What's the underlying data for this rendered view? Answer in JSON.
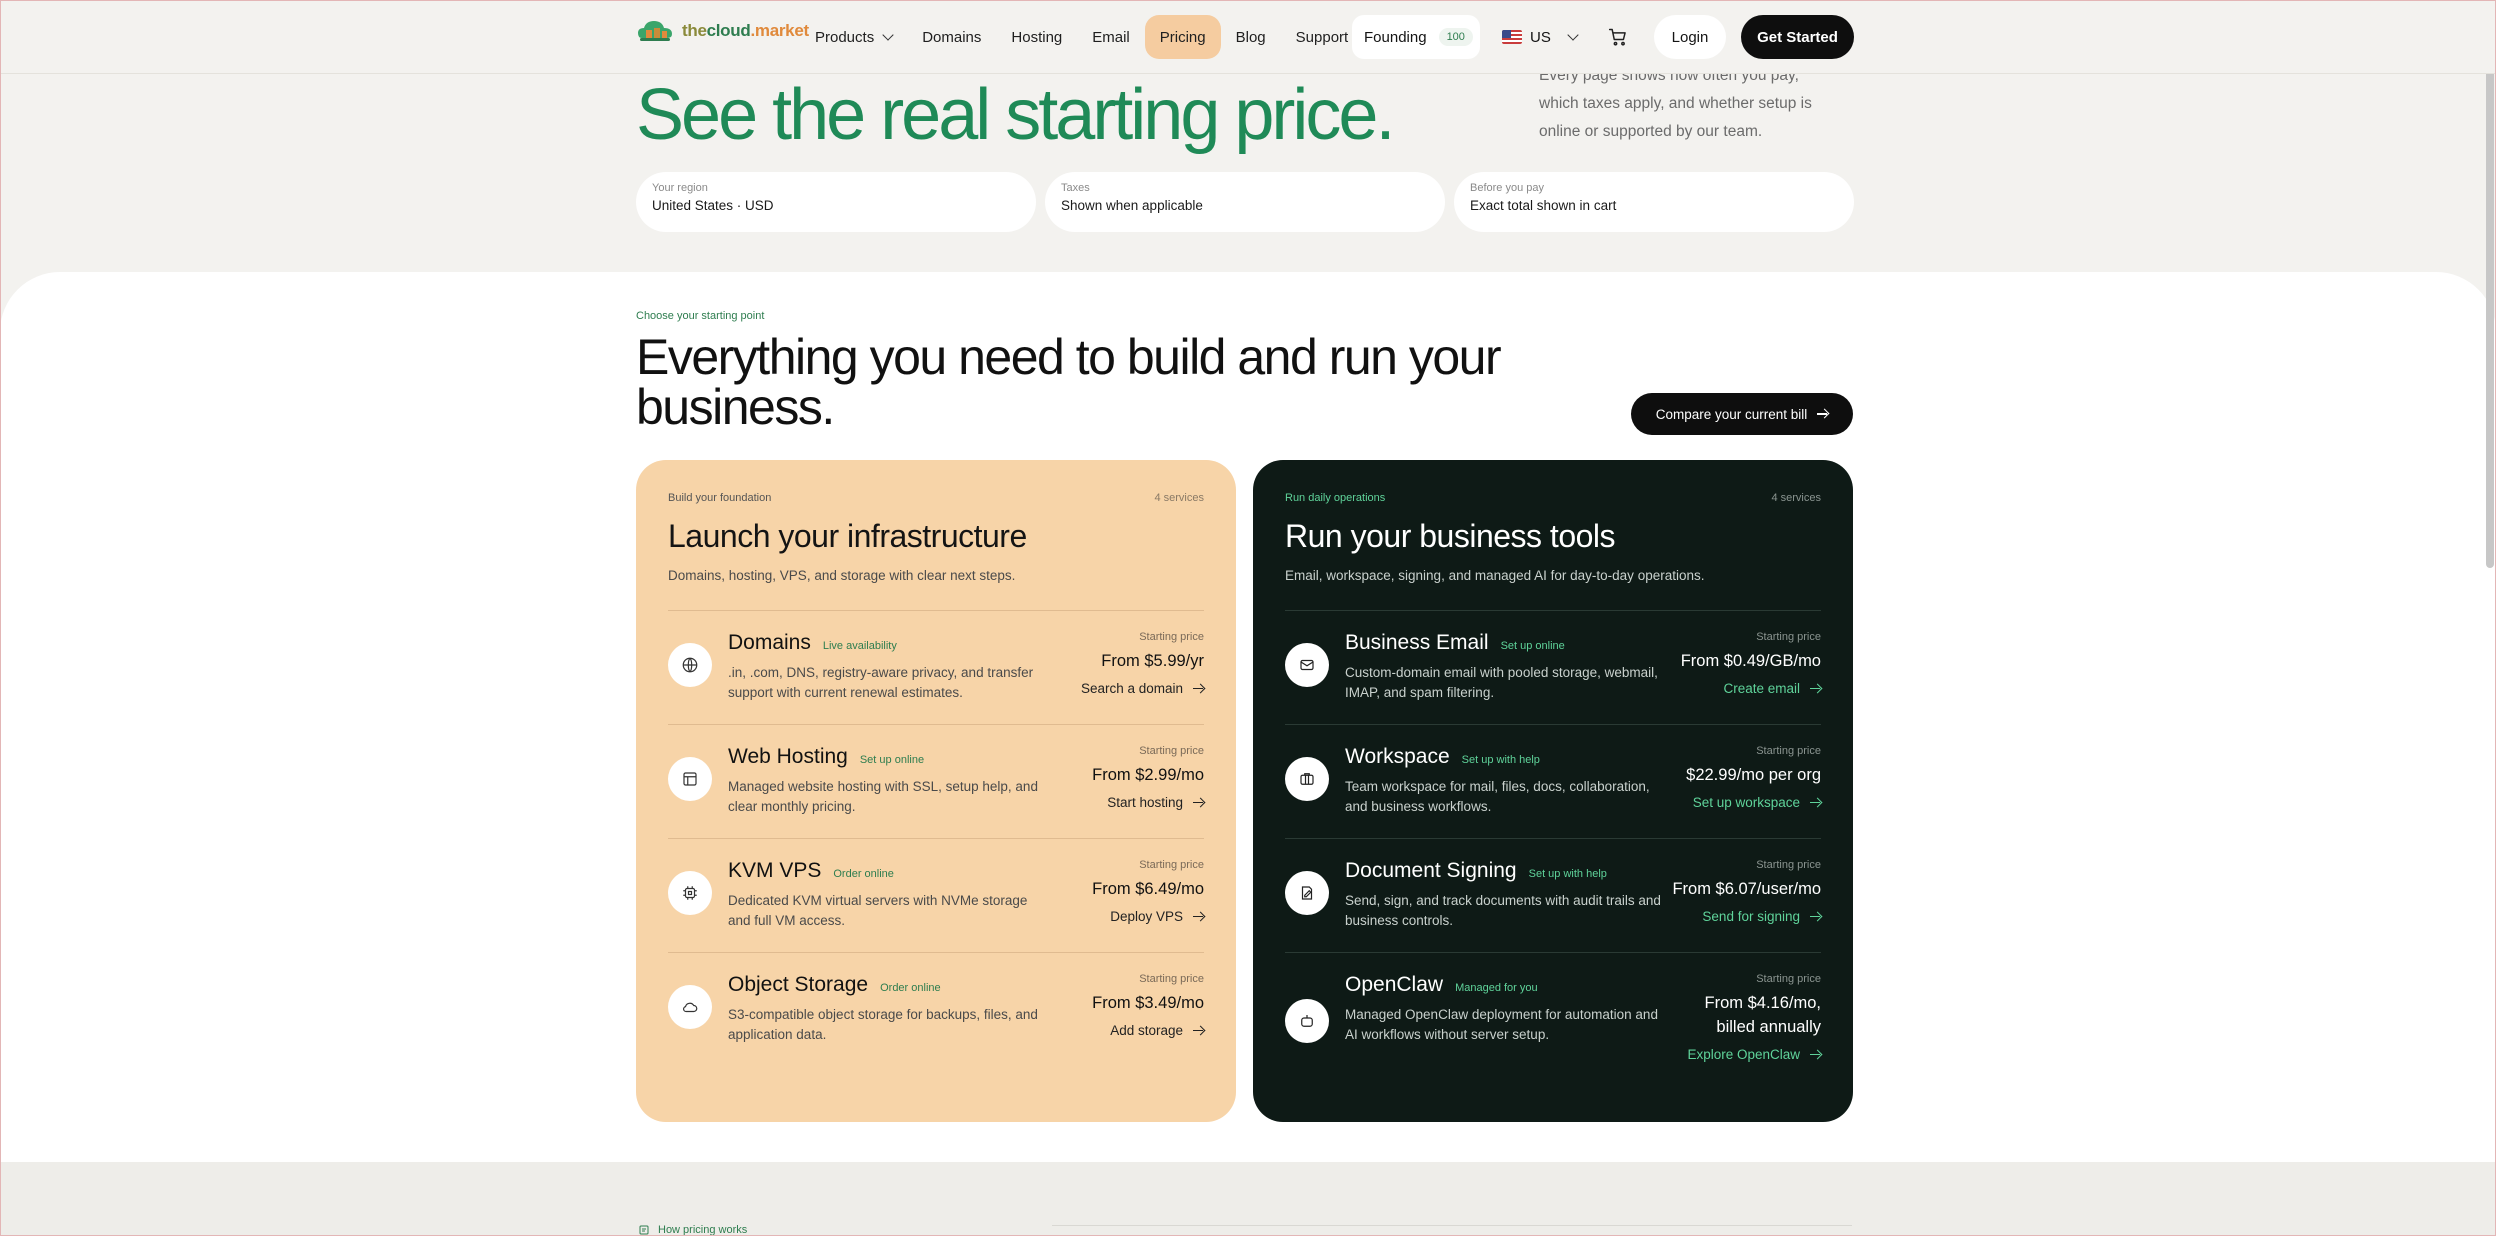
{
  "nav": {
    "logo": {
      "part1": "the",
      "part2": "cloud",
      "part3": ".market"
    },
    "links": [
      "Products",
      "Domains",
      "Hosting",
      "Email",
      "Pricing",
      "Blog",
      "Support"
    ],
    "active_link": "Pricing",
    "founding_label": "Founding",
    "founding_badge": "100",
    "region_label": "US",
    "login_label": "Login",
    "get_started_label": "Get Started"
  },
  "hero": {
    "title": "See the real starting price.",
    "note": "Every page shows how often you pay, which taxes apply, and whether setup is online or supported by our team.",
    "pills": [
      {
        "label": "Your region",
        "value": "United States · USD"
      },
      {
        "label": "Taxes",
        "value": "Shown when applicable"
      },
      {
        "label": "Before you pay",
        "value": "Exact total shown in cart"
      }
    ]
  },
  "section": {
    "eyebrow": "Choose your starting point",
    "title": "Everything you need to build and run your business.",
    "compare_label": "Compare your current bill"
  },
  "cards": [
    {
      "eyebrow": "Build your foundation",
      "count": "4 services",
      "title": "Launch your infrastructure",
      "desc": "Domains, hosting, VPS, and storage with clear next steps.",
      "rows": [
        {
          "icon": "globe-icon",
          "name": "Domains",
          "tag": "Live availability",
          "desc": ".in, .com, DNS, registry-aware privacy, and transfer support with current renewal estimates.",
          "price_label": "Starting price",
          "price": "From $5.99/yr",
          "link": "Search a domain"
        },
        {
          "icon": "hosting-icon",
          "name": "Web Hosting",
          "tag": "Set up online",
          "desc": "Managed website hosting with SSL, setup help, and clear monthly pricing.",
          "price_label": "Starting price",
          "price": "From $2.99/mo",
          "link": "Start hosting"
        },
        {
          "icon": "cpu-icon",
          "name": "KVM VPS",
          "tag": "Order online",
          "desc": "Dedicated KVM virtual servers with NVMe storage and full VM access.",
          "price_label": "Starting price",
          "price": "From $6.49/mo",
          "link": "Deploy VPS"
        },
        {
          "icon": "cloud-icon",
          "name": "Object Storage",
          "tag": "Order online",
          "desc": "S3-compatible object storage for backups, files, and application data.",
          "price_label": "Starting price",
          "price": "From $3.49/mo",
          "link": "Add storage"
        }
      ]
    },
    {
      "eyebrow": "Run daily operations",
      "count": "4 services",
      "title": "Run your business tools",
      "desc": "Email, workspace, signing, and managed AI for day-to-day operations.",
      "rows": [
        {
          "icon": "mail-icon",
          "name": "Business Email",
          "tag": "Set up online",
          "desc": "Custom-domain email with pooled storage, webmail, IMAP, and spam filtering.",
          "price_label": "Starting price",
          "price": "From $0.49/GB/mo",
          "link": "Create email"
        },
        {
          "icon": "briefcase-icon",
          "name": "Workspace",
          "tag": "Set up with help",
          "desc": "Team workspace for mail, files, docs, collaboration, and business workflows.",
          "price_label": "Starting price",
          "price": "$22.99/mo per org",
          "link": "Set up workspace"
        },
        {
          "icon": "sign-icon",
          "name": "Document Signing",
          "tag": "Set up with help",
          "desc": "Send, sign, and track documents with audit trails and business controls.",
          "price_label": "Starting price",
          "price": "From $6.07/user/mo",
          "link": "Send for signing"
        },
        {
          "icon": "robot-icon",
          "name": "OpenClaw",
          "tag": "Managed for you",
          "desc": "Managed OpenClaw deployment for automation and AI workflows without server setup.",
          "price_label": "Starting price",
          "price": "From $4.16/mo, billed annually",
          "link": "Explore OpenClaw"
        }
      ]
    }
  ],
  "bottom": {
    "eyebrow": "How pricing works"
  }
}
